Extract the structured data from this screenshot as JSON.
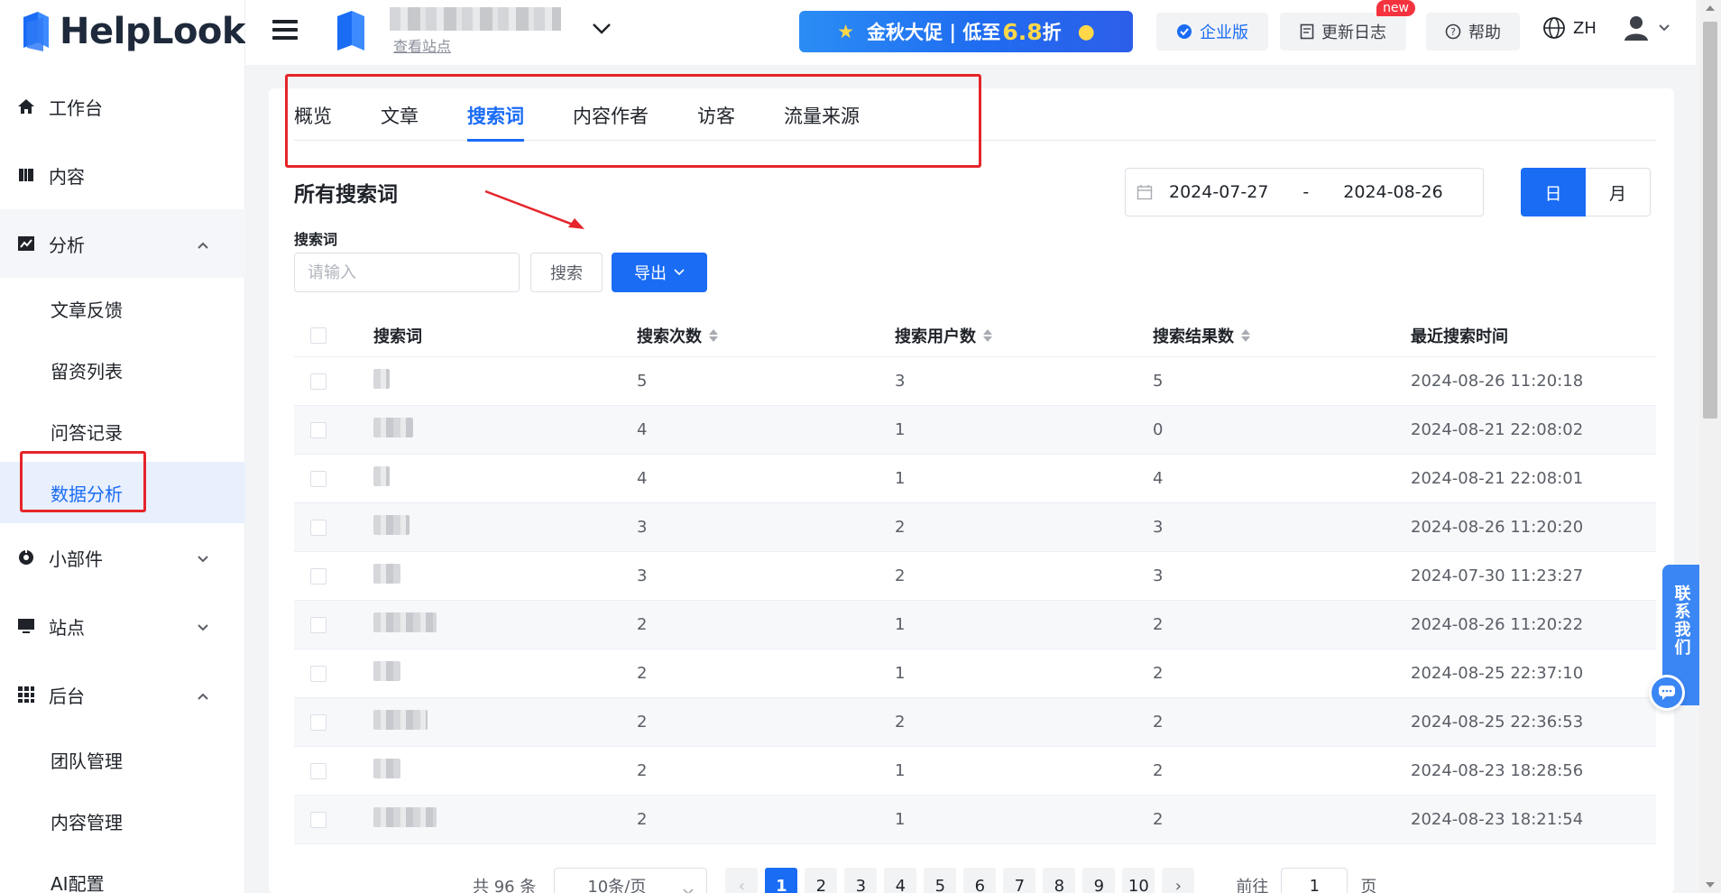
{
  "brand": {
    "name": "HelpLook"
  },
  "sidebar": {
    "items": [
      {
        "label": "工作台",
        "icon": "home-icon"
      },
      {
        "label": "内容",
        "icon": "book-icon"
      },
      {
        "label": "分析",
        "icon": "chart-icon"
      },
      {
        "label": "小部件",
        "icon": "widget-icon"
      },
      {
        "label": "站点",
        "icon": "monitor-icon"
      },
      {
        "label": "后台",
        "icon": "grid-icon"
      }
    ],
    "analysis_sub": [
      "文章反馈",
      "留资列表",
      "问答记录",
      "数据分析"
    ],
    "backend_sub": [
      "团队管理",
      "内容管理",
      "AI配置"
    ],
    "active_sub": "数据分析"
  },
  "header": {
    "view_site": "查看站点",
    "promo_text": "金秋大促 | 低至",
    "promo_num": "6.8",
    "promo_suffix": "折",
    "enterprise": "企业版",
    "changelog": "更新日志",
    "new_badge": "new",
    "help": "帮助",
    "lang": "ZH"
  },
  "tabs": [
    "概览",
    "文章",
    "搜索词",
    "内容作者",
    "访客",
    "流量来源"
  ],
  "active_tab": "搜索词",
  "section_title": "所有搜索词",
  "date_range": {
    "start": "2024-07-27",
    "sep": "-",
    "end": "2024-08-26"
  },
  "granularity": {
    "day": "日",
    "month": "月",
    "selected": "日"
  },
  "filter": {
    "label": "搜索词",
    "placeholder": "请输入",
    "search_btn": "搜索",
    "export_btn": "导出"
  },
  "table": {
    "headers": [
      "搜索词",
      "搜索次数",
      "搜索用户数",
      "搜索结果数",
      "最近搜索时间"
    ],
    "rows": [
      {
        "searches": "5",
        "users": "3",
        "results": "5",
        "time": "2024-08-26 11:20:18"
      },
      {
        "searches": "4",
        "users": "1",
        "results": "0",
        "time": "2024-08-21 22:08:02"
      },
      {
        "searches": "4",
        "users": "1",
        "results": "4",
        "time": "2024-08-21 22:08:01"
      },
      {
        "searches": "3",
        "users": "2",
        "results": "3",
        "time": "2024-08-26 11:20:20"
      },
      {
        "searches": "3",
        "users": "2",
        "results": "3",
        "time": "2024-07-30 11:23:27"
      },
      {
        "searches": "2",
        "users": "1",
        "results": "2",
        "time": "2024-08-26 11:20:22"
      },
      {
        "searches": "2",
        "users": "1",
        "results": "2",
        "time": "2024-08-25 22:37:10"
      },
      {
        "searches": "2",
        "users": "2",
        "results": "2",
        "time": "2024-08-25 22:36:53"
      },
      {
        "searches": "2",
        "users": "1",
        "results": "2",
        "time": "2024-08-23 18:28:56"
      },
      {
        "searches": "2",
        "users": "1",
        "results": "2",
        "time": "2024-08-23 18:21:54"
      }
    ]
  },
  "pagination": {
    "total": "共 96 条",
    "page_size": "10条/页",
    "pages": [
      "1",
      "2",
      "3",
      "4",
      "5",
      "6",
      "7",
      "8",
      "9",
      "10"
    ],
    "current": "1",
    "goto_label": "前往",
    "goto_value": "1",
    "goto_suffix": "页"
  },
  "contact": {
    "label": "联系我们"
  },
  "colors": {
    "primary": "#1a6cf5",
    "annotation_red": "#e5252a"
  }
}
